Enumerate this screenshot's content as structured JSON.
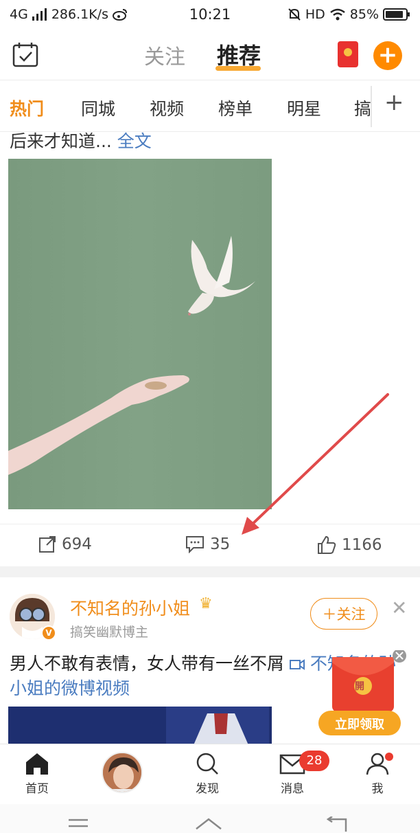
{
  "status_bar": {
    "network": "4G",
    "speed": "286.1K/s",
    "time": "10:21",
    "hd": "HD",
    "battery": "85%"
  },
  "top_nav": {
    "tabs": [
      "关注",
      "推荐"
    ],
    "active_tab": "推荐",
    "accent_color": "#f7a833"
  },
  "categories": {
    "items": [
      "热门",
      "同城",
      "视频",
      "榜单",
      "明星",
      "搞"
    ],
    "active": "热门",
    "add_label": "+"
  },
  "post1": {
    "text_tail": "后来才知道...",
    "fulltext_link": "全文",
    "actions": {
      "repost_count": "694",
      "comment_count": "35",
      "like_count": "1166"
    }
  },
  "post2": {
    "author": "不知名的孙小姐",
    "author_subtitle": "搞笑幽默博主",
    "follow_label": "＋关注",
    "text": "男人不敢有表情，女人带有一丝不屑",
    "video_link": "不知名的孙小姐的微博视频"
  },
  "floating_envelope": {
    "badge": "開",
    "label": "立即领取"
  },
  "tabbar": {
    "items": [
      "首页",
      "",
      "发现",
      "消息",
      "我"
    ],
    "message_badge": "28"
  },
  "colors": {
    "orange": "#f08d1b",
    "link_blue": "#4a7cc0",
    "red": "#ea3b2f",
    "annotation_arrow": "#e04a4a"
  }
}
